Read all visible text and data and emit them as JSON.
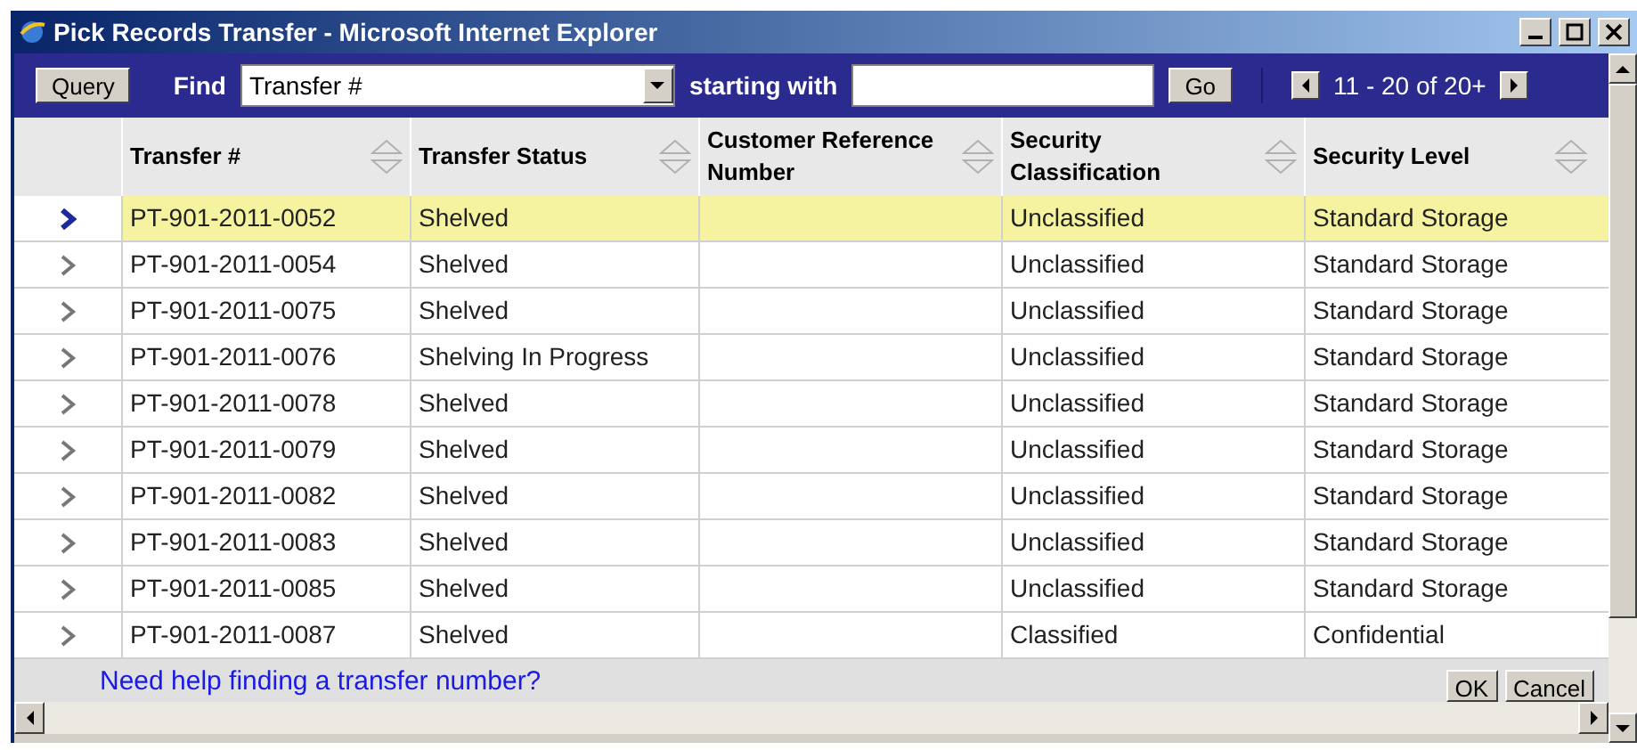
{
  "window": {
    "title": "Pick Records Transfer - Microsoft Internet Explorer"
  },
  "toolbar": {
    "query_button": "Query",
    "find_label": "Find",
    "find_select": "Transfer #",
    "starting_label": "starting with",
    "go_button": "Go",
    "paging": "11 - 20 of 20+"
  },
  "table": {
    "columns": [
      "Transfer #",
      "Transfer Status",
      "Customer Reference Number",
      "Security Classification",
      "Security Level"
    ],
    "rows": [
      {
        "selected": true,
        "cells": [
          "PT-901-2011-0052",
          "Shelved",
          "",
          "Unclassified",
          "Standard Storage"
        ]
      },
      {
        "selected": false,
        "cells": [
          "PT-901-2011-0054",
          "Shelved",
          "",
          "Unclassified",
          "Standard Storage"
        ]
      },
      {
        "selected": false,
        "cells": [
          "PT-901-2011-0075",
          "Shelved",
          "",
          "Unclassified",
          "Standard Storage"
        ]
      },
      {
        "selected": false,
        "cells": [
          "PT-901-2011-0076",
          "Shelving In Progress",
          "",
          "Unclassified",
          "Standard Storage"
        ]
      },
      {
        "selected": false,
        "cells": [
          "PT-901-2011-0078",
          "Shelved",
          "",
          "Unclassified",
          "Standard Storage"
        ]
      },
      {
        "selected": false,
        "cells": [
          "PT-901-2011-0079",
          "Shelved",
          "",
          "Unclassified",
          "Standard Storage"
        ]
      },
      {
        "selected": false,
        "cells": [
          "PT-901-2011-0082",
          "Shelved",
          "",
          "Unclassified",
          "Standard Storage"
        ]
      },
      {
        "selected": false,
        "cells": [
          "PT-901-2011-0083",
          "Shelved",
          "",
          "Unclassified",
          "Standard Storage"
        ]
      },
      {
        "selected": false,
        "cells": [
          "PT-901-2011-0085",
          "Shelved",
          "",
          "Unclassified",
          "Standard Storage"
        ]
      },
      {
        "selected": false,
        "cells": [
          "PT-901-2011-0087",
          "Shelved",
          "",
          "Classified",
          "Confidential"
        ]
      }
    ]
  },
  "footer": {
    "help_link": "Need help finding a transfer number?",
    "ok_button": "OK",
    "cancel_button": "Cancel"
  }
}
